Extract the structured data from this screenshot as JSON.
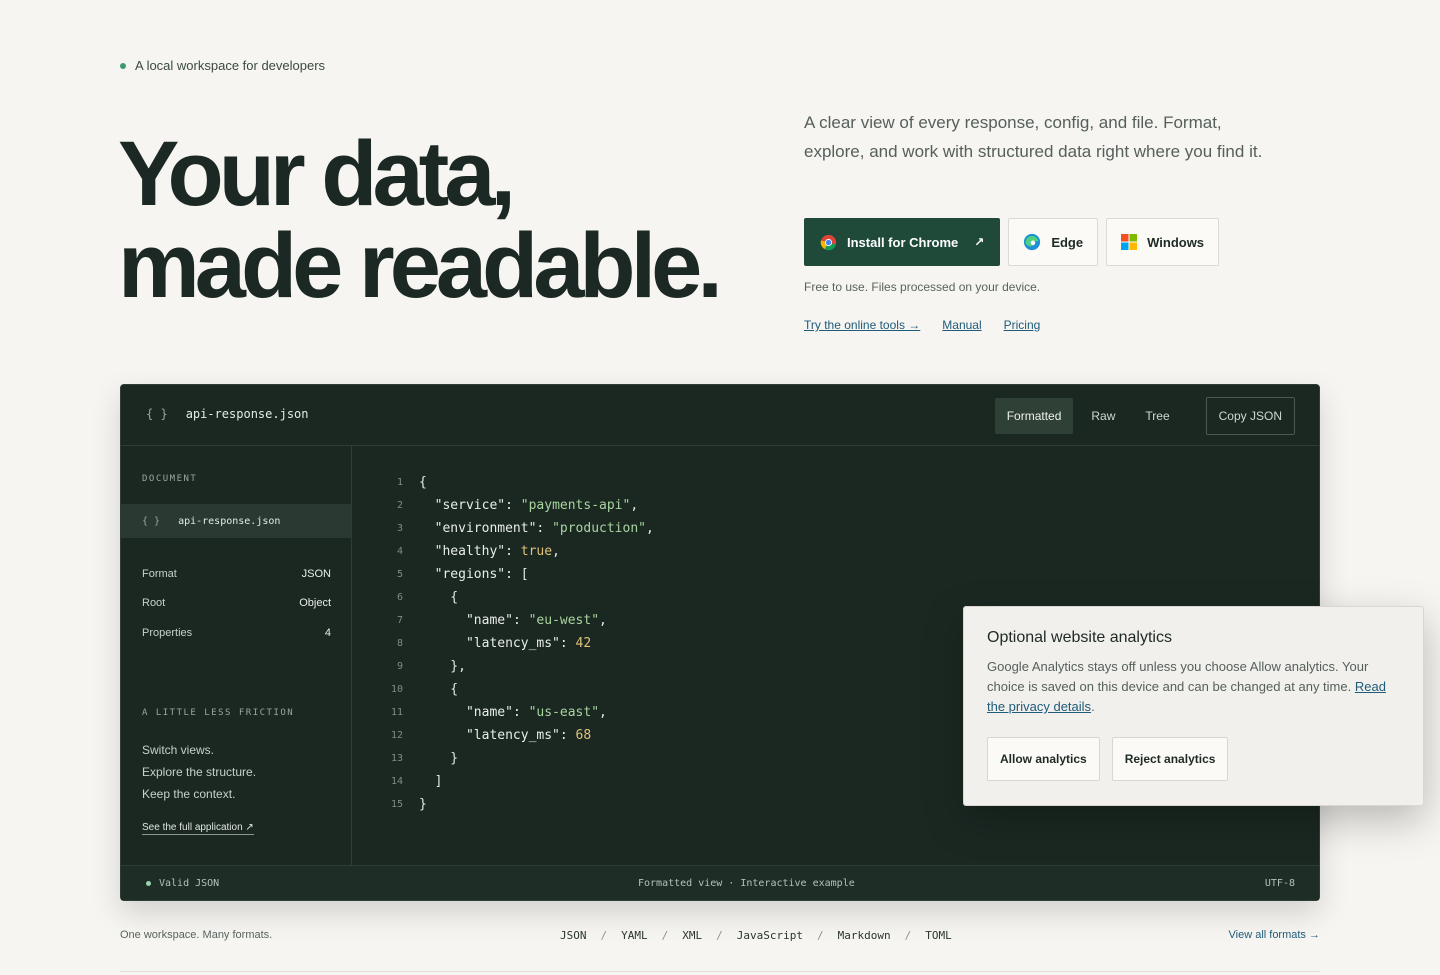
{
  "eyebrow": "A local workspace for developers",
  "hero": {
    "line1": "Your data,",
    "line2": "made readable.",
    "intro": "A clear view of every response, config, and file. Format, explore, and work with structured data right where you find it.",
    "buttons": {
      "chrome": "Install for Chrome",
      "edge": "Edge",
      "windows": "Windows"
    },
    "note": "Free to use. Files processed on your device.",
    "links": {
      "online_tools": "Try the online tools →",
      "manual": "Manual",
      "pricing": "Pricing"
    }
  },
  "viewer": {
    "braces": "{ }",
    "filename": "api-response.json",
    "tabs": [
      "Formatted",
      "Raw",
      "Tree"
    ],
    "copy": "Copy JSON",
    "sidebar": {
      "document_label": "DOCUMENT",
      "file": "api-response.json",
      "meta": [
        {
          "key": "Format",
          "value": "JSON"
        },
        {
          "key": "Root",
          "value": "Object"
        },
        {
          "key": "Properties",
          "value": "4"
        }
      ],
      "friction_label": "A LITTLE LESS FRICTION",
      "friction_lines": [
        "Switch views.",
        "Explore the structure.",
        "Keep the context."
      ],
      "full_link": "See the full application ↗"
    },
    "code": [
      "{",
      "  \"service\": \"payments-api\",",
      "  \"environment\": \"production\",",
      "  \"healthy\": true,",
      "  \"regions\": [",
      "    {",
      "      \"name\": \"eu-west\",",
      "      \"latency_ms\": 42",
      "    },",
      "    {",
      "      \"name\": \"us-east\",",
      "      \"latency_ms\": 68",
      "    }",
      "  ]",
      "}"
    ],
    "line_numbers": [
      "1",
      "2",
      "3",
      "4",
      "5",
      "6",
      "7",
      "8",
      "9",
      "10",
      "11",
      "12",
      "13",
      "14",
      "15"
    ],
    "footer": {
      "status": "Valid JSON",
      "center": "Formatted view · Interactive example",
      "encoding": "UTF-8"
    }
  },
  "consent": {
    "title": "Optional website analytics",
    "body": "Google Analytics stays off unless you choose Allow analytics. Your choice is saved on this device and can be changed at any time.",
    "link": "Read the privacy details",
    "allow": "Allow analytics",
    "reject": "Reject analytics"
  },
  "strip": {
    "left": "One workspace. Many formats.",
    "formats": [
      "JSON",
      "YAML",
      "XML",
      "JavaScript",
      "Markdown",
      "TOML"
    ],
    "sep": "/",
    "right": "View all formats →"
  },
  "colors": {
    "primary": "#1f4a3a",
    "viewer_bg": "#1b2822",
    "accent_dot": "#3d9a6f",
    "link": "#1f5b7a"
  }
}
